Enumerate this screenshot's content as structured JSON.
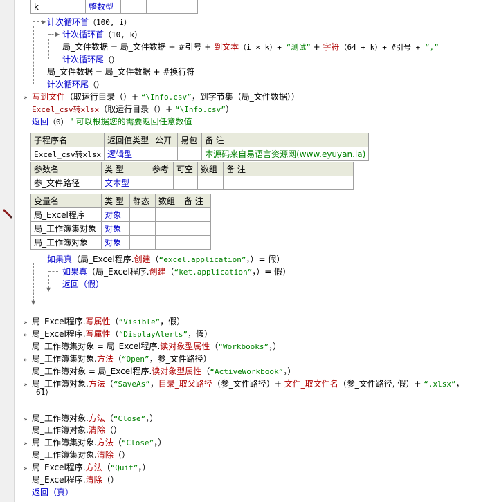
{
  "top_table": {
    "name": "k",
    "type": "整数型"
  },
  "loop_outer_start": {
    "kw": "计次循环首",
    "args": "（100, i）"
  },
  "loop_inner_start": {
    "kw": "计次循环首",
    "args": "（10, k）"
  },
  "assign_line": {
    "var": "局_文件数据",
    "p1": " = 局_文件数据 + #引号 + ",
    "f1": "到文本",
    "p2": "（i × k）+ ",
    "s1": "“测试”",
    "p3": " + ",
    "f2": "字符",
    "p4": "（64 + k）+ #引号 + ",
    "s2": "“,”"
  },
  "loop_inner_end": {
    "kw": "计次循环尾",
    "args": "（）"
  },
  "newline_line": "局_文件数据 = 局_文件数据 + #换行符",
  "loop_outer_end": {
    "kw": "计次循环尾",
    "args": "（）"
  },
  "write_file": {
    "f": "写到文件",
    "p1": "（取运行目录（）+ ",
    "s": "“\\Info.csv”",
    "p2": "，到字节集（局_文件数据））"
  },
  "call_convert": {
    "f": "Excel_csv转xlsx",
    "p1": "（取运行目录（）+ ",
    "s": "“\\Info.csv”",
    "p2": "）"
  },
  "return_line": {
    "kw": "返回",
    "args": "（0）",
    "comment": "' 可以根据您的需要返回任意数值"
  },
  "sub_table": {
    "headers": [
      "子程序名",
      "返回值类型",
      "公开",
      "易包",
      "备 注"
    ],
    "row": {
      "name": "Excel_csv转xlsx",
      "ret": "逻辑型",
      "note": "本源码来自易语言资源网(www.eyuyan.la)"
    },
    "param_headers": [
      "参数名",
      "类 型",
      "参考",
      "可空",
      "数组",
      "备 注"
    ],
    "param_row": {
      "name": "参_文件路径",
      "type": "文本型"
    }
  },
  "var_table": {
    "headers": [
      "变量名",
      "类 型",
      "静态",
      "数组",
      "备 注"
    ],
    "rows": [
      {
        "name": "局_Excel程序",
        "type": "对象"
      },
      {
        "name": "局_工作簿集对象",
        "type": "对象"
      },
      {
        "name": "局_工作簿对象",
        "type": "对象"
      }
    ]
  },
  "if1": {
    "kw": "如果真",
    "p1": "（局_Excel程序.",
    "m": "创建",
    "p2": "（",
    "s": "“excel.application”",
    "p3": "，）= 假）"
  },
  "if2": {
    "kw": "如果真",
    "p1": "（局_Excel程序.",
    "m": "创建",
    "p2": "（",
    "s": "“ket.application”",
    "p3": "，）= 假）"
  },
  "if_return": "返回（假）",
  "code": {
    "l1": {
      "obj": "局_Excel程序.",
      "m": "写属性",
      "p1": "（",
      "s": "“Visible”",
      "p2": "，假）"
    },
    "l2": {
      "obj": "局_Excel程序.",
      "m": "写属性",
      "p1": "（",
      "s": "“DisplayAlerts”",
      "p2": "，假）"
    },
    "l3": {
      "a": "局_工作簿集对象 = 局_Excel程序.",
      "m": "读对象型属性",
      "p1": "（",
      "s": "“Workbooks”",
      "p2": "，）"
    },
    "l4": {
      "obj": "局_工作簿集对象.",
      "m": "方法",
      "p1": "（",
      "s": "“Open”",
      "p2": "，参_文件路径）"
    },
    "l5": {
      "a": "局_工作簿对象 = 局_Excel程序.",
      "m": "读对象型属性",
      "p1": "（",
      "s": "“ActiveWorkbook”",
      "p2": "，）"
    },
    "l6": {
      "obj": "局_工作簿对象.",
      "m": "方法",
      "p1": "（",
      "s": "“SaveAs”",
      "p2": "，",
      "f1": "目录_取父路径",
      "p3": "（参_文件路径）+ ",
      "f2": "文件_取文件名",
      "p4": "（参_文件路径, 假）+ ",
      "s2": "“.xlsx”",
      "p5": "，",
      "cont": "61）"
    },
    "l7": {
      "obj": "局_工作簿对象.",
      "m": "方法",
      "p1": "（",
      "s": "“Close”",
      "p2": "，）"
    },
    "l8": {
      "obj": "局_工作簿对象.",
      "m": "清除",
      "p1": "（）"
    },
    "l9": {
      "obj": "局_工作簿集对象.",
      "m": "方法",
      "p1": "（",
      "s": "“Close”",
      "p2": "，）"
    },
    "l10": {
      "obj": "局_工作簿集对象.",
      "m": "清除",
      "p1": "（）"
    },
    "l11": {
      "obj": "局_Excel程序.",
      "m": "方法",
      "p1": "（",
      "s": "“Quit”",
      "p2": "，）"
    },
    "l12": {
      "obj": "局_Excel程序.",
      "m": "清除",
      "p1": "（）"
    },
    "l13": "返回（真）"
  }
}
